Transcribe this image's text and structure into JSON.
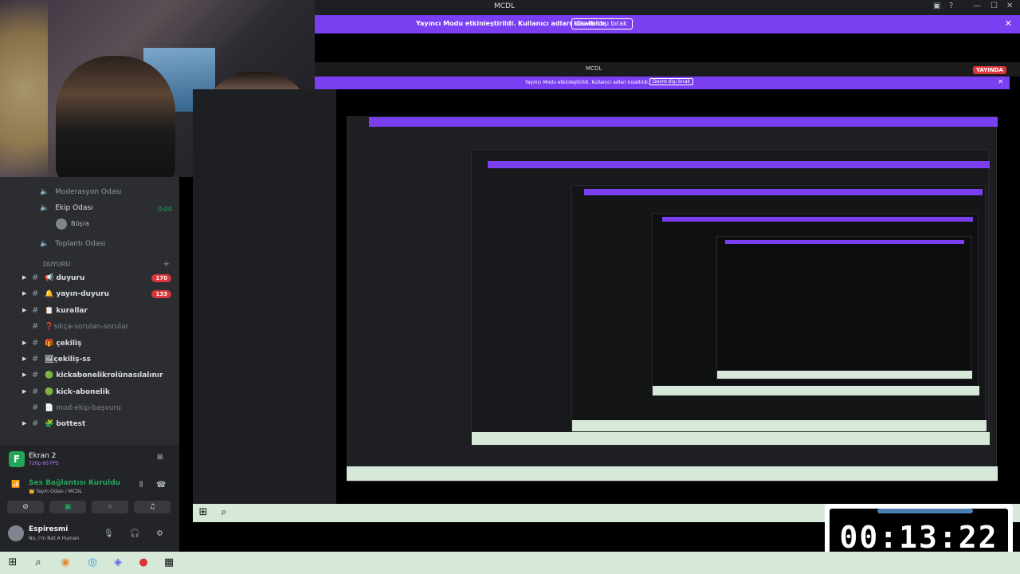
{
  "window": {
    "title": "MCDL"
  },
  "streamer_banner": {
    "message": "Yayıncı Modu etkinleştirildi. Kullanıcı adları kısaltıldı.",
    "button": "Devre dışı bırak"
  },
  "nested": {
    "title": "MCDL",
    "live_badge": "YAYINDA",
    "message": "Yayıncı Modu etkinleştirildi. Kullanıcı adları kısaltıldı.",
    "button": "Devre dışı bırak"
  },
  "voice_channels": [
    {
      "name": "Moderasyon Odası"
    },
    {
      "name": "Ekip Odası",
      "time": "0:00",
      "member": "Büşra"
    },
    {
      "name": "Toplantı Odası"
    }
  ],
  "category": {
    "name": "DUYURU"
  },
  "channels": [
    {
      "name": "📢 duyuru",
      "badge": "170"
    },
    {
      "name": "🔔 yayın-duyuru",
      "badge": "133"
    },
    {
      "name": "📋 kurallar"
    },
    {
      "name": "❓sıkça-sorulan-sorular",
      "muted": true
    },
    {
      "name": "🎁 çekiliş"
    },
    {
      "name": "🖼çekiliş-ss"
    },
    {
      "name": "🟢 kickabonelikrolünasılalınır"
    },
    {
      "name": "🟢 kick-abonelik"
    },
    {
      "name": "📄 mod-ekip-başvuru",
      "muted": true
    },
    {
      "name": "🧩 bottest"
    }
  ],
  "voice_panel": {
    "app_name": "Ekran 2",
    "app_sub": "720p 60 FPS",
    "status": "Ses Bağlantısı Kuruldu",
    "channel": "👑 Yayın Odası / MCDL",
    "user": "Espiresmi",
    "user_status": "No, I'm Not A Human"
  },
  "timer": {
    "value": "00:13:22"
  },
  "colors": {
    "accent": "#7b3ff2",
    "green": "#23a559",
    "red": "#da373c"
  }
}
